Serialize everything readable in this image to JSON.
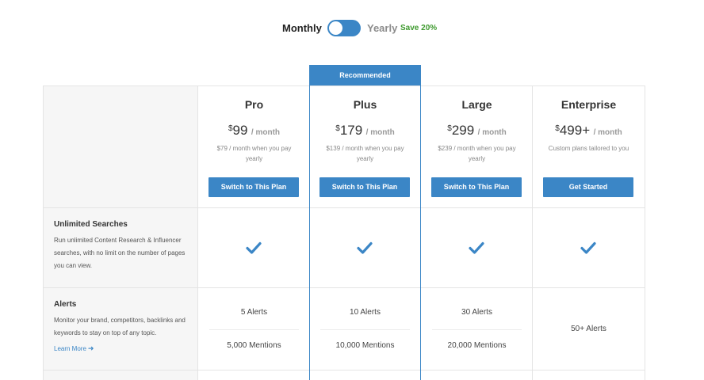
{
  "billing": {
    "monthly_label": "Monthly",
    "yearly_label": "Yearly",
    "save_label": "Save 20%",
    "toggle_state": "monthly"
  },
  "recommended_label": "Recommended",
  "plans": [
    {
      "name": "Pro",
      "currency": "$",
      "price": "99",
      "per": "/ month",
      "note": "$79 / month when you pay yearly",
      "button": "Switch to This Plan",
      "alerts": "5 Alerts",
      "mentions": "5,000 Mentions"
    },
    {
      "name": "Plus",
      "currency": "$",
      "price": "179",
      "per": "/ month",
      "note": "$139 / month when you pay yearly",
      "button": "Switch to This Plan",
      "alerts": "10 Alerts",
      "mentions": "10,000 Mentions"
    },
    {
      "name": "Large",
      "currency": "$",
      "price": "299",
      "per": "/ month",
      "note": "$239 / month when you pay yearly",
      "button": "Switch to This Plan",
      "alerts": "30 Alerts",
      "mentions": "20,000 Mentions"
    },
    {
      "name": "Enterprise",
      "currency": "$",
      "price": "499+",
      "per": "/ month",
      "note": "Custom plans tailored to you",
      "button": "Get Started",
      "alerts": "50+ Alerts"
    }
  ],
  "features": {
    "unlimited_searches": {
      "title": "Unlimited Searches",
      "description": "Run unlimited Content Research & Influencer searches, with no limit on the number of pages you can view."
    },
    "alerts": {
      "title": "Alerts",
      "description": "Monitor your brand, competitors, backlinks and keywords to stay on top of any topic.",
      "link": "Learn More"
    }
  },
  "colors": {
    "accent": "#3b86c6",
    "save": "#3f9a2f",
    "sidebar_bg": "#f6f6f6",
    "border": "#e4e4e4"
  },
  "icons": {
    "check": "check-icon",
    "arrow": "arrow-right-icon"
  }
}
